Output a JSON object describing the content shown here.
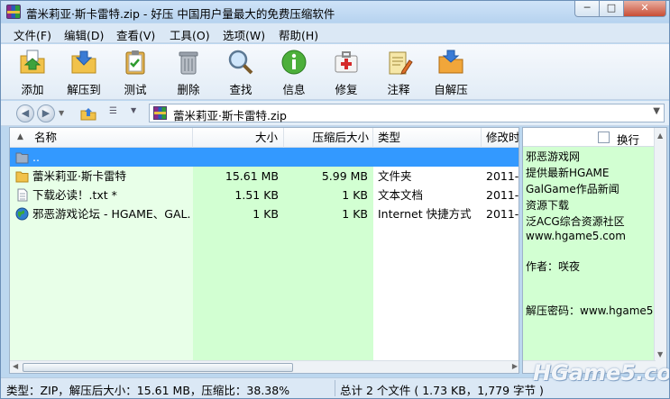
{
  "window": {
    "title": "蕾米莉亚·斯卡雷特.zip - 好压 中国用户量最大的免费压缩软件",
    "min_glyph": "─",
    "max_glyph": "□",
    "close_glyph": "✕"
  },
  "menu": [
    "文件(F)",
    "编辑(D)",
    "查看(V)",
    "工具(O)",
    "选项(W)",
    "帮助(H)"
  ],
  "toolbar": [
    "添加",
    "解压到",
    "测试",
    "删除",
    "查找",
    "信息",
    "修复",
    "注释",
    "自解压"
  ],
  "address": {
    "back_glyph": "◀",
    "forward_glyph": "▶",
    "path": "蕾米莉亚·斯卡雷特.zip",
    "dropdown_glyph": "▼"
  },
  "columns": {
    "name": "名称",
    "size": "大小",
    "packed": "压缩后大小",
    "type": "类型",
    "modified": "修改时"
  },
  "files": [
    {
      "name": "..",
      "size": "",
      "packed": "",
      "type": "",
      "modified": "",
      "icon": "parent-folder-icon"
    },
    {
      "name": "蕾米莉亚·斯卡雷特",
      "size": "15.61 MB",
      "packed": "5.99 MB",
      "type": "文件夹",
      "modified": "2011-(",
      "icon": "folder-icon"
    },
    {
      "name": "下载必读！.txt *",
      "size": "1.51 KB",
      "packed": "1 KB",
      "type": "文本文档",
      "modified": "2011-(",
      "icon": "text-file-icon"
    },
    {
      "name": "邪恶游戏论坛 - HGAME、GAL...",
      "size": "1 KB",
      "packed": "1 KB",
      "type": "Internet 快捷方式",
      "modified": "2011-(",
      "icon": "internet-shortcut-icon"
    }
  ],
  "comment": {
    "wrap_label": "换行",
    "lines": [
      "邪恶游戏网",
      "提供最新HGAME",
      "GalGame作品新闻",
      "资源下载",
      "泛ACG综合资源社区",
      "www.hgame5.com",
      "",
      "作者：咲夜",
      "",
      "",
      "解压密码：www.hgame5."
    ]
  },
  "status": {
    "left": "类型：ZIP，解压后大小：15.61 MB，压缩比：38.38%",
    "right": "总计 2 个文件 ( 1.73 KB，1,779 字节 )"
  },
  "watermark": "HGame5.com",
  "colors": {
    "selection": "#3399ff",
    "name_column_bg": "#e8ffe8",
    "size_column_bg": "#d2ffd2",
    "comment_bg": "#d2ffd2"
  }
}
